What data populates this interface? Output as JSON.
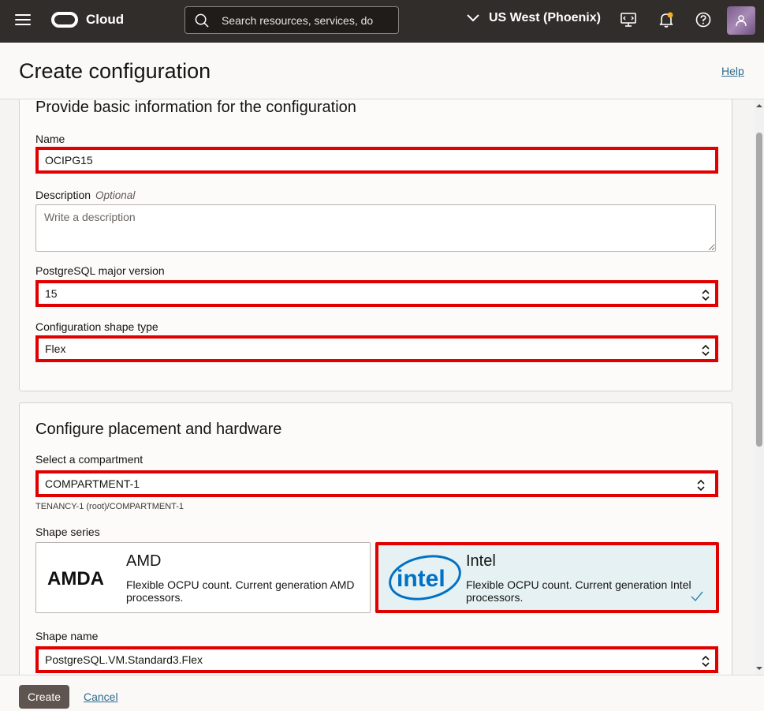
{
  "nav": {
    "brand": "Cloud",
    "search_placeholder": "Search resources, services, documentation, and Marketplace",
    "region": "US West (Phoenix)"
  },
  "header": {
    "title": "Create configuration",
    "help": "Help"
  },
  "basic": {
    "title": "Provide basic information for the configuration",
    "name_label": "Name",
    "name_value": "OCIPG15",
    "description_label": "Description",
    "optional": "Optional",
    "description_placeholder": "Write a description",
    "version_label": "PostgreSQL major version",
    "version_value": "15",
    "shape_type_label": "Configuration shape type",
    "shape_type_value": "Flex"
  },
  "placement": {
    "title": "Configure placement and hardware",
    "compartment_label": "Select a compartment",
    "compartment_value": "COMPARTMENT-1",
    "compartment_path": "TENANCY-1 (root)/COMPARTMENT-1",
    "shape_series_label": "Shape series",
    "amd": {
      "logo": "AMDA",
      "title": "AMD",
      "desc": "Flexible OCPU count. Current generation AMD processors."
    },
    "intel": {
      "logo": "intel",
      "title": "Intel",
      "desc": "Flexible OCPU count. Current generation Intel processors.",
      "selected": true
    },
    "shape_name_label": "Shape name",
    "shape_name_value": "PostgreSQL.VM.Standard3.Flex"
  },
  "footer": {
    "create": "Create",
    "cancel": "Cancel"
  },
  "colors": {
    "topbar": "#312d2a",
    "highlight": "#e00000",
    "link": "#2b6b8d",
    "selected_card": "#e6f1f4"
  }
}
